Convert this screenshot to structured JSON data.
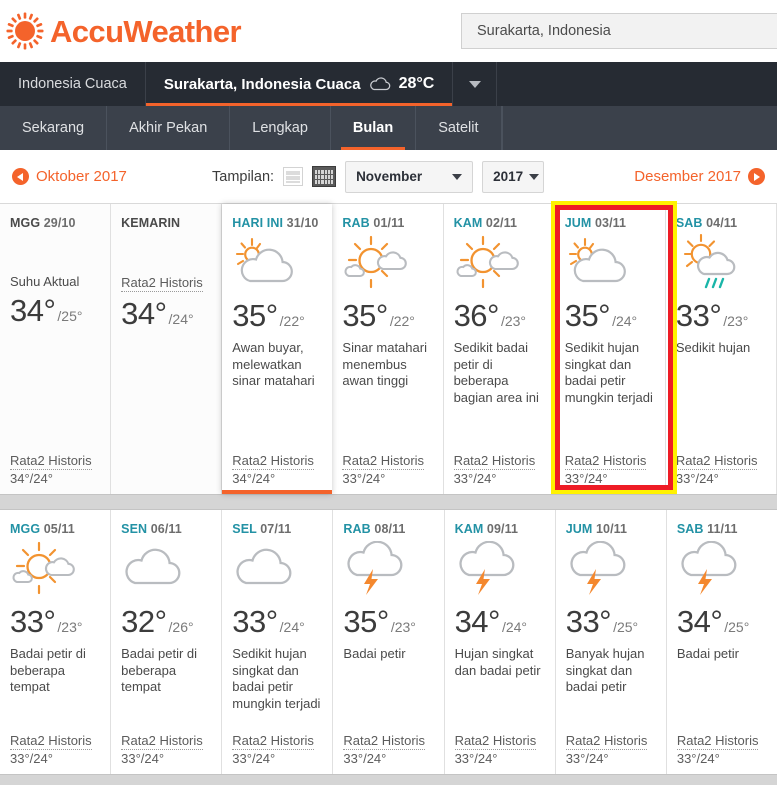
{
  "brand": {
    "name": "AccuWeather",
    "logo_icon": "sun-icon",
    "accent": "#f4632b"
  },
  "search": {
    "value": "Surakarta, Indonesia",
    "placeholder": "Surakarta, Indonesia"
  },
  "navbar": {
    "region_label": "Indonesia Cuaca",
    "location_label": "Surakarta, Indonesia Cuaca",
    "current_temp": "28°C",
    "current_icon": "cloud-icon",
    "dropdown_icon": "chevron-down-icon"
  },
  "tabs": [
    {
      "label": "Sekarang",
      "active": false
    },
    {
      "label": "Akhir Pekan",
      "active": false
    },
    {
      "label": "Lengkap",
      "active": false
    },
    {
      "label": "Bulan",
      "active": true
    },
    {
      "label": "Satelit",
      "active": false
    }
  ],
  "controls": {
    "prev_month": "Oktober 2017",
    "next_month": "Desember 2017",
    "view_label": "Tampilan:",
    "view_list_icon": "list-view-icon",
    "view_calendar_icon": "calendar-view-icon",
    "month_selected": "November",
    "year_selected": "2017",
    "prev_icon": "arrow-left-circle-icon",
    "next_icon": "arrow-right-circle-icon",
    "caret_icon": "chevron-down-icon"
  },
  "labels": {
    "historical": "Rata2 Historis",
    "actual": "Suhu Aktual"
  },
  "weeks": [
    {
      "days": [
        {
          "dow": "MGG",
          "dnum": "29/10",
          "dow_plain": false,
          "icon": "none",
          "high": "",
          "low": "",
          "phrase": "",
          "actual_label": "Suhu Aktual",
          "actual_temp": "34°",
          "actual_low": "/25°",
          "hist_label": "Rata2 Historis",
          "hist_val": "34°/24°",
          "style": "past"
        },
        {
          "dow": "KEMARIN",
          "dnum": "",
          "dow_plain": true,
          "icon": "none",
          "high": "",
          "low": "",
          "phrase": "",
          "hist_top_label": "Rata2 Historis",
          "hist_top_temp": "34°",
          "hist_top_low": "/24°",
          "style": "past"
        },
        {
          "dow": "HARI INI",
          "dnum": "31/10",
          "dow_plain": false,
          "icon": "mostly-cloudy-icon",
          "high": "35°",
          "low": "/22°",
          "phrase": "Awan buyar, melewatkan sinar matahari",
          "hist_label": "Rata2 Historis",
          "hist_val": "34°/24°",
          "style": "today"
        },
        {
          "dow": "RAB",
          "dnum": "01/11",
          "dow_plain": false,
          "icon": "partly-sunny-icon",
          "high": "35°",
          "low": "/22°",
          "phrase": "Sinar matahari menembus awan tinggi",
          "hist_label": "Rata2 Historis",
          "hist_val": "33°/24°",
          "style": "normal"
        },
        {
          "dow": "KAM",
          "dnum": "02/11",
          "dow_plain": false,
          "icon": "partly-sunny-icon",
          "high": "36°",
          "low": "/23°",
          "phrase": "Sedikit badai petir di beberapa bagian area ini",
          "hist_label": "Rata2 Historis",
          "hist_val": "33°/24°",
          "style": "normal"
        },
        {
          "dow": "JUM",
          "dnum": "03/11",
          "dow_plain": false,
          "icon": "mostly-cloudy-icon",
          "high": "35°",
          "low": "/24°",
          "phrase": "Sedikit hujan singkat dan badai petir mungkin terjadi",
          "hist_label": "Rata2 Historis",
          "hist_val": "33°/24°",
          "style": "normal",
          "highlighted": true
        },
        {
          "dow": "SAB",
          "dnum": "04/11",
          "dow_plain": false,
          "icon": "sun-cloud-rain-icon",
          "high": "33°",
          "low": "/23°",
          "phrase": "Sedikit hujan",
          "hist_label": "Rata2 Historis",
          "hist_val": "33°/24°",
          "style": "normal"
        }
      ]
    },
    {
      "days": [
        {
          "dow": "MGG",
          "dnum": "05/11",
          "dow_plain": false,
          "icon": "partly-sunny-icon",
          "high": "33°",
          "low": "/23°",
          "phrase": "Badai petir di beberapa tempat",
          "hist_label": "Rata2 Historis",
          "hist_val": "33°/24°"
        },
        {
          "dow": "SEN",
          "dnum": "06/11",
          "dow_plain": false,
          "icon": "cloudy-icon",
          "high": "32°",
          "low": "/26°",
          "phrase": "Badai petir di beberapa tempat",
          "hist_label": "Rata2 Historis",
          "hist_val": "33°/24°"
        },
        {
          "dow": "SEL",
          "dnum": "07/11",
          "dow_plain": false,
          "icon": "cloudy-icon",
          "high": "33°",
          "low": "/24°",
          "phrase": "Sedikit hujan singkat dan badai petir mungkin terjadi",
          "hist_label": "Rata2 Historis",
          "hist_val": "33°/24°"
        },
        {
          "dow": "RAB",
          "dnum": "08/11",
          "dow_plain": false,
          "icon": "thunderstorm-icon",
          "high": "35°",
          "low": "/23°",
          "phrase": "Badai petir",
          "hist_label": "Rata2 Historis",
          "hist_val": "33°/24°"
        },
        {
          "dow": "KAM",
          "dnum": "09/11",
          "dow_plain": false,
          "icon": "thunderstorm-icon",
          "high": "34°",
          "low": "/24°",
          "phrase": "Hujan singkat dan badai petir",
          "hist_label": "Rata2 Historis",
          "hist_val": "33°/24°"
        },
        {
          "dow": "JUM",
          "dnum": "10/11",
          "dow_plain": false,
          "icon": "thunderstorm-icon",
          "high": "33°",
          "low": "/25°",
          "phrase": "Banyak hujan singkat dan badai petir",
          "hist_label": "Rata2 Historis",
          "hist_val": "33°/24°"
        },
        {
          "dow": "SAB",
          "dnum": "11/11",
          "dow_plain": false,
          "icon": "thunderstorm-icon",
          "high": "34°",
          "low": "/25°",
          "phrase": "Badai petir",
          "hist_label": "Rata2 Historis",
          "hist_val": "33°/24°"
        }
      ]
    }
  ],
  "annotation": {
    "highlight_outer": "#fff200",
    "highlight_inner": "#ee1c25"
  }
}
